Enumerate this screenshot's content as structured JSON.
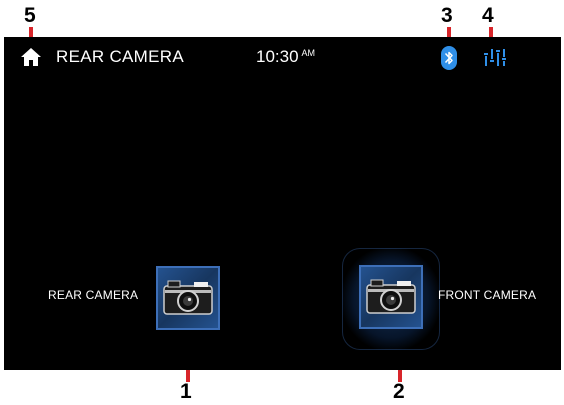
{
  "callouts": [
    "1",
    "2",
    "3",
    "4",
    "5"
  ],
  "statusbar": {
    "home_icon": "home-icon",
    "title": "REAR CAMERA",
    "time": "10:30",
    "ampm": "AM",
    "bluetooth_icon": "bluetooth-icon",
    "equalizer_icon": "equalizer-icon"
  },
  "cameras": {
    "rear_label": "REAR CAMERA",
    "front_label": "FRONT CAMERA",
    "icon": "camera-icon"
  },
  "colors": {
    "callout_line": "#d8252a",
    "accent_blue": "#2f8fe8",
    "button_border": "#3d6fb8"
  }
}
